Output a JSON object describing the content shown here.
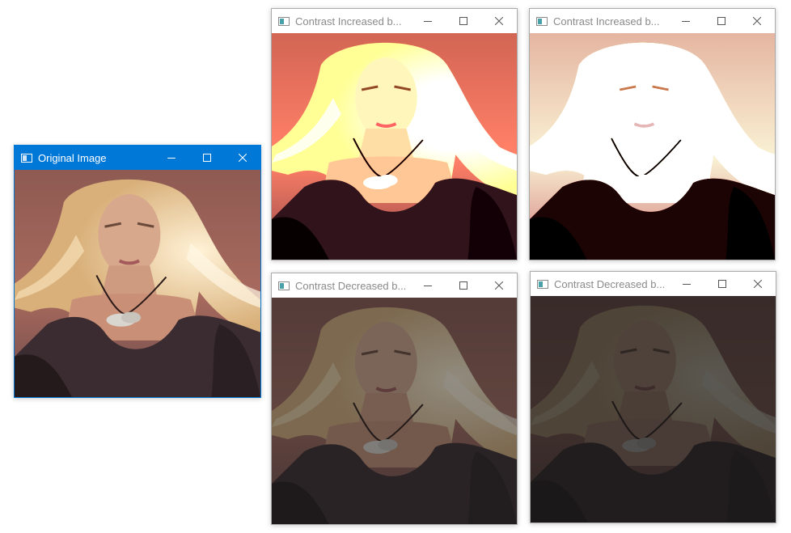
{
  "windows": [
    {
      "title": "Original Image",
      "state": "active",
      "effect": "none"
    },
    {
      "title": "Contrast Increased b...",
      "state": "inactive",
      "effect": "increased-1"
    },
    {
      "title": "Contrast Increased b...",
      "state": "inactive",
      "effect": "increased-2"
    },
    {
      "title": "Contrast Decreased b...",
      "state": "inactive",
      "effect": "decreased-1"
    },
    {
      "title": "Contrast Decreased b...",
      "state": "inactive",
      "effect": "decreased-2"
    }
  ],
  "controls": {
    "minimize_icon": "minimize-icon",
    "maximize_icon": "maximize-icon",
    "close_icon": "close-icon"
  },
  "colors": {
    "active_titlebar": "#0078d7",
    "active_title_text": "#ffffff",
    "inactive_titlebar": "#ffffff",
    "inactive_title_text": "#8a8a8a",
    "photo_background": "#a86a5e",
    "hair": "#e8cfa0",
    "skin": "#d9a98c",
    "top_clothing": "#3a2c30"
  }
}
